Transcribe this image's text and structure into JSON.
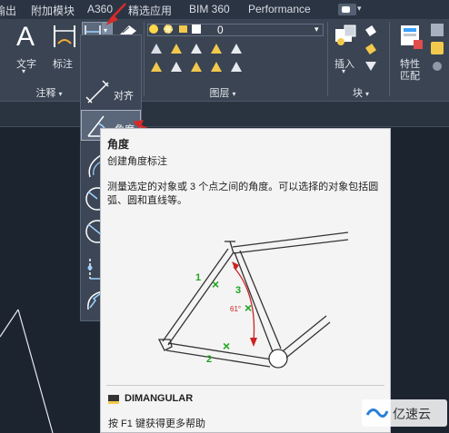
{
  "tabs": [
    "输出",
    "附加模块",
    "A360",
    "精选应用",
    "BIM 360",
    "Performance"
  ],
  "ribbon": {
    "text_label": "文字",
    "dim_label": "标注",
    "annot_panel": "注释",
    "linear_label": "线性",
    "layer_value": "0",
    "layer_panel": "图层",
    "insert_label": "插入",
    "block_panel": "块",
    "props_label_1": "特性",
    "props_label_2": "匹配",
    "caret": "▾"
  },
  "flyout": {
    "align_label": "对齐",
    "angle_label": "角度"
  },
  "tooltip": {
    "title": "角度",
    "subtitle": "创建角度标注",
    "desc_line1": "测量选定的对象或 3 个点之间的角度。可以选择的对象包括圆",
    "desc_line2": "弧、圆和直线等。",
    "pick1": "1",
    "pick2": "2",
    "pick3": "3",
    "angle_value": "61°",
    "command": "DIMANGULAR",
    "help": "按 F1 键获得更多帮助"
  },
  "watermark": "亿速云",
  "colors": {
    "accent_red": "#d62b2b",
    "marker_green": "#1fa51f",
    "angle_red": "#cc2222"
  },
  "icons": [
    "text-icon",
    "dimension-icon",
    "linear-dim-icon",
    "layer-lightbulb-icon",
    "insert-block-icon",
    "match-properties-icon",
    "aligned-dim-icon",
    "angular-dim-icon",
    "arc-length-icon",
    "radius-icon",
    "diameter-icon",
    "ordinate-icon",
    "jogged-icon",
    "help-f1-icon",
    "watermark-logo"
  ]
}
